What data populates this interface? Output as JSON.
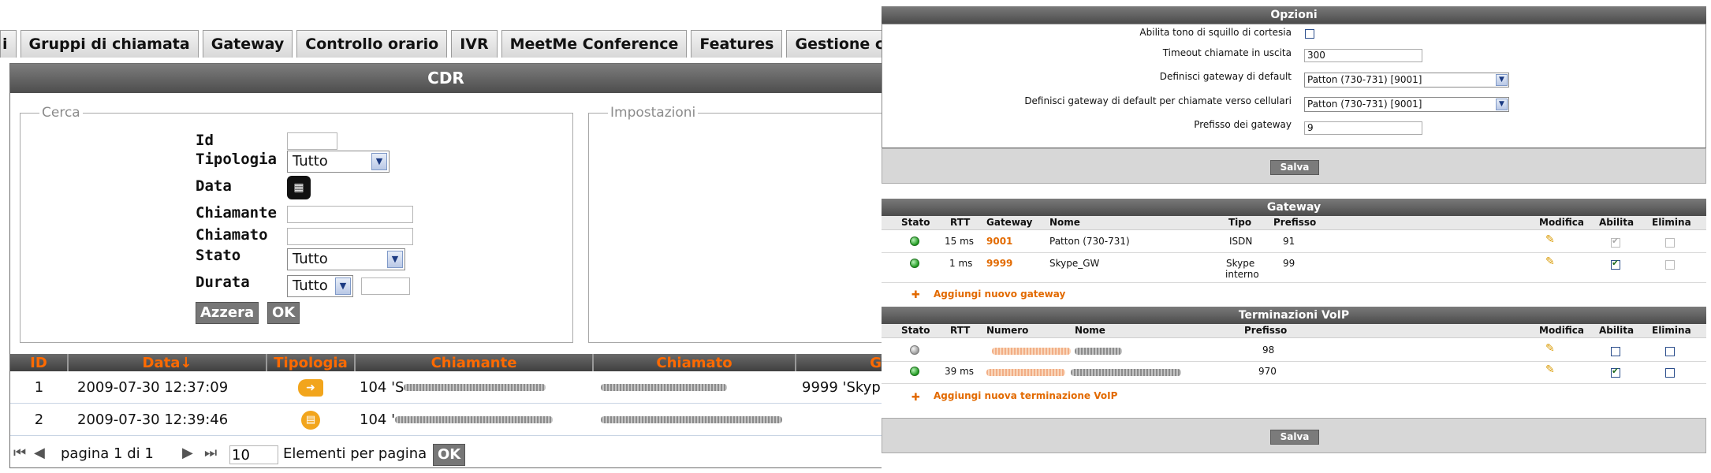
{
  "tabs": [
    "i",
    "Gruppi di chiamata",
    "Gateway",
    "Controllo orario",
    "IVR",
    "MeetMe Conference",
    "Features",
    "Gestione chia"
  ],
  "cdr": {
    "title": "CDR",
    "cerca": {
      "legend": "Cerca",
      "id_label": "Id",
      "tipologia_label": "Tipologia",
      "tipologia_value": "Tutto",
      "data_label": "Data",
      "chiamante_label": "Chiamante",
      "chiamato_label": "Chiamato",
      "stato_label": "Stato",
      "stato_value": "Tutto",
      "durata_label": "Durata",
      "durata_value": "Tutto",
      "reset_button": "Azzera",
      "ok_button": "OK"
    },
    "impostazioni": {
      "legend": "Impostazioni"
    },
    "table": {
      "headers": [
        "ID",
        "Data↓",
        "Tipologia",
        "Chiamante",
        "Chiamato",
        "G"
      ],
      "rows": [
        {
          "id": "1",
          "date": "2009-07-30 12:37:09",
          "chiamante": "104 'S",
          "chiamato": "",
          "gateway": "9999 'Skyp"
        },
        {
          "id": "2",
          "date": "2009-07-30 12:39:46",
          "chiamante": "104 '",
          "chiamato": "",
          "gateway": ""
        }
      ]
    },
    "pager": {
      "page_text": "pagina 1 di 1",
      "per_page_value": "10",
      "per_page_label": "Elementi per pagina",
      "ok_button": "OK"
    }
  },
  "opzioni": {
    "title": "Opzioni",
    "fields": {
      "ring_label": "Abilita tono di squillo di cortesia",
      "timeout_label": "Timeout chiamate in uscita",
      "timeout_value": "300",
      "default_gw_label": "Definisci gateway di default",
      "default_gw_value": "Patton (730-731) [9001]",
      "mobile_gw_label": "Definisci gateway di default per chiamate verso cellulari",
      "mobile_gw_value": "Patton (730-731) [9001]",
      "prefix_label": "Prefisso dei gateway",
      "prefix_value": "9"
    },
    "save_button": "Salva"
  },
  "gateway": {
    "title": "Gateway",
    "headers": {
      "stato": "Stato",
      "rtt": "RTT",
      "gateway": "Gateway",
      "nome": "Nome",
      "tipo": "Tipo",
      "prefisso": "Prefisso",
      "modifica": "Modifica",
      "abilita": "Abilita",
      "elimina": "Elimina"
    },
    "rows": [
      {
        "rtt": "15 ms",
        "code": "9001",
        "nome": "Patton (730-731)",
        "tipo": "ISDN",
        "prefisso": "91"
      },
      {
        "rtt": "1 ms",
        "code": "9999",
        "nome": "Skype_GW",
        "tipo": "Skype",
        "tipo2": "interno",
        "prefisso": "99"
      }
    ],
    "add_link": "Aggiungi nuovo gateway"
  },
  "voip": {
    "title": "Terminazioni VoIP",
    "headers": {
      "stato": "Stato",
      "rtt": "RTT",
      "numero": "Numero",
      "nome": "Nome",
      "prefisso": "Prefisso",
      "modifica": "Modifica",
      "abilita": "Abilita",
      "elimina": "Elimina"
    },
    "rows": [
      {
        "rtt": "",
        "prefisso": "98"
      },
      {
        "rtt": "39 ms",
        "prefisso": "970"
      }
    ],
    "add_link": "Aggiungi nuova terminazione VoIP",
    "save_button": "Salva"
  },
  "colors": {
    "accent": "#e26a00",
    "header_dark": "#4b4b4b",
    "status_ok": "#1f9a1f"
  }
}
